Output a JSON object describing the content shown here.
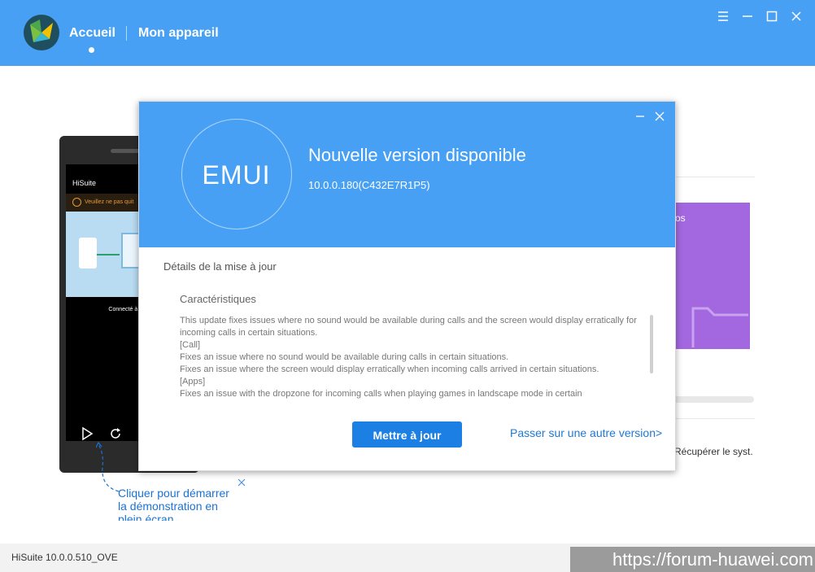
{
  "header": {
    "nav_home": "Accueil",
    "nav_device": "Mon appareil"
  },
  "phone": {
    "app_title": "HiSuite",
    "warning_text": "Veuillez ne pas quit",
    "connected_text": "Connecté à Laptop"
  },
  "tip": {
    "text": "Cliquer pour démarrer la démonstration en plein écran"
  },
  "background": {
    "purple_card_text": "os",
    "recover_link": "Récupérer le syst."
  },
  "dialog": {
    "logo_text": "EMUI",
    "title": "Nouvelle version disponible",
    "build": "10.0.0.180(C432E7R1P5)",
    "details_title": "Détails de la mise à jour",
    "features_title": "Caractéristiques",
    "notes": [
      "This update fixes issues where no sound would be available during calls and the screen would display erratically for incoming calls in certain situations.",
      "[Call]",
      "Fixes an issue where no sound would be available during calls in certain situations.",
      "Fixes an issue where the screen would display erratically when incoming calls arrived in certain situations.",
      "[Apps]",
      "Fixes an issue with the dropzone for incoming calls when playing games in landscape mode in certain"
    ],
    "update_button": "Mettre à jour",
    "other_version_link": "Passer sur une autre version>"
  },
  "status": {
    "version": "HiSuite 10.0.0.510_OVE",
    "watermark": "https://forum-huawei.com"
  },
  "colors": {
    "header_blue": "#47a0f3",
    "button_blue": "#1b7fe4",
    "purple_card": "#a367e0"
  }
}
